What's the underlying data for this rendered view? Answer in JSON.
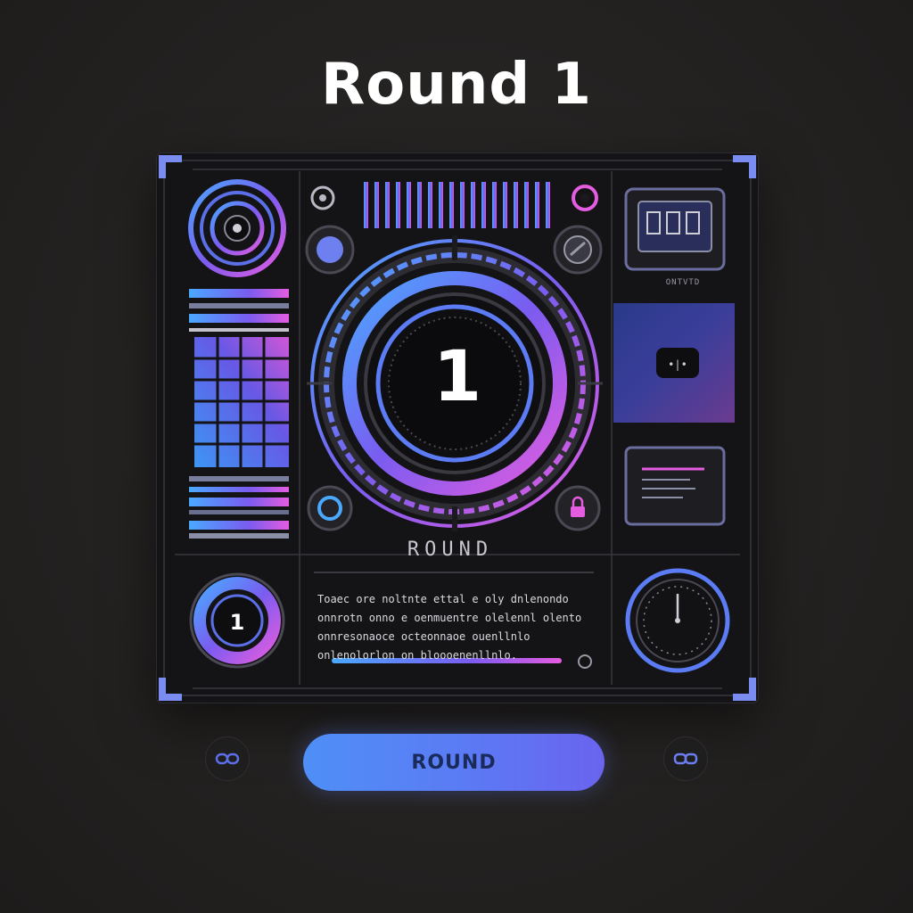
{
  "title": "Round 1",
  "dial": {
    "number": "1"
  },
  "mini_dial": {
    "number": "1"
  },
  "round_label": "ROUND",
  "monitor": {
    "label": "ONTVTD"
  },
  "screen_text": "Toaec ore noltnte ettal e oly dnlenondo\nonnrotn onno e oenmuentre olelennl olento\nonnresonaoce octeonnaoe ouenllnlo\nonlenolorlon on bloooenenllnlo.",
  "button": {
    "label": "ROUND"
  },
  "icons": {
    "left_side": "link-icon",
    "right_side": "link-icon",
    "lock": "lock-icon",
    "gauge": "clock-icon"
  },
  "colors": {
    "accent_blue": "#4f8ff7",
    "accent_violet": "#7a5cf0",
    "accent_pink": "#e45ce0",
    "panel": "#141315"
  }
}
